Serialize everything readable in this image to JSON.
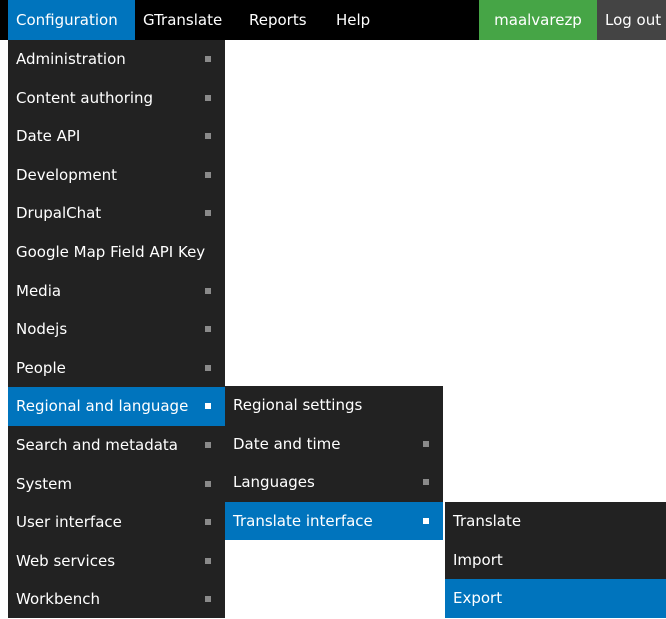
{
  "topbar": {
    "items": [
      {
        "label": "Configuration"
      },
      {
        "label": "GTranslate"
      },
      {
        "label": "Reports"
      },
      {
        "label": "Help"
      }
    ],
    "user": "maalvarezp",
    "logout": "Log out"
  },
  "menu1": {
    "items": [
      {
        "label": "Administration"
      },
      {
        "label": "Content authoring"
      },
      {
        "label": "Date API"
      },
      {
        "label": "Development"
      },
      {
        "label": "DrupalChat"
      },
      {
        "label": "Google Map Field API Key"
      },
      {
        "label": "Media"
      },
      {
        "label": "Nodejs"
      },
      {
        "label": "People"
      },
      {
        "label": "Regional and language"
      },
      {
        "label": "Search and metadata"
      },
      {
        "label": "System"
      },
      {
        "label": "User interface"
      },
      {
        "label": "Web services"
      },
      {
        "label": "Workbench"
      }
    ]
  },
  "menu2": {
    "items": [
      {
        "label": "Regional settings"
      },
      {
        "label": "Date and time"
      },
      {
        "label": "Languages"
      },
      {
        "label": "Translate interface"
      }
    ]
  },
  "menu3": {
    "items": [
      {
        "label": "Translate"
      },
      {
        "label": "Import"
      },
      {
        "label": "Export"
      }
    ]
  },
  "colors": {
    "active": "#0074bd",
    "user_badge": "#46a546",
    "menu_bg": "#222222",
    "topbar_bg": "#000000"
  }
}
